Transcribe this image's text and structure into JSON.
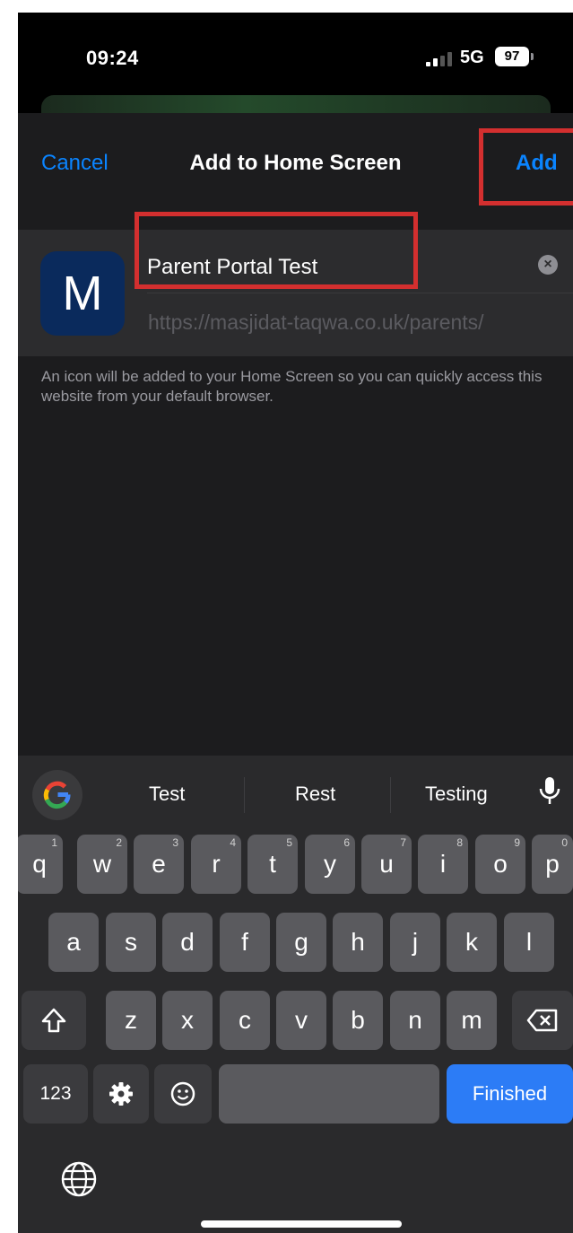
{
  "status_bar": {
    "time": "09:24",
    "network": "5G",
    "battery": "97"
  },
  "sheet": {
    "cancel_label": "Cancel",
    "title": "Add to Home Screen",
    "add_label": "Add",
    "icon_letter": "M",
    "name_value": "Parent Portal Test",
    "url": "https://masjidat-taqwa.co.uk/parents/",
    "note": "An icon will be added to your Home Screen so you can quickly access this website from your default browser."
  },
  "keyboard": {
    "suggestions": [
      "Test",
      "Rest",
      "Testing"
    ],
    "row1": [
      {
        "k": "q",
        "n": "1"
      },
      {
        "k": "w",
        "n": "2"
      },
      {
        "k": "e",
        "n": "3"
      },
      {
        "k": "r",
        "n": "4"
      },
      {
        "k": "t",
        "n": "5"
      },
      {
        "k": "y",
        "n": "6"
      },
      {
        "k": "u",
        "n": "7"
      },
      {
        "k": "i",
        "n": "8"
      },
      {
        "k": "o",
        "n": "9"
      },
      {
        "k": "p",
        "n": "0"
      }
    ],
    "row2": [
      "a",
      "s",
      "d",
      "f",
      "g",
      "h",
      "j",
      "k",
      "l"
    ],
    "row3": [
      "z",
      "x",
      "c",
      "v",
      "b",
      "n",
      "m"
    ],
    "numbers_label": "123",
    "return_label": "Finished"
  },
  "icons": [
    "google-g-icon",
    "microphone-icon",
    "shift-icon",
    "backspace-icon",
    "gear-icon",
    "emoji-icon",
    "globe-icon",
    "clear-icon"
  ],
  "colors": {
    "accent": "#0a84ff",
    "highlight": "#d32f2f",
    "return_key": "#2c7cf6",
    "app_icon": "#0a2a5c"
  }
}
